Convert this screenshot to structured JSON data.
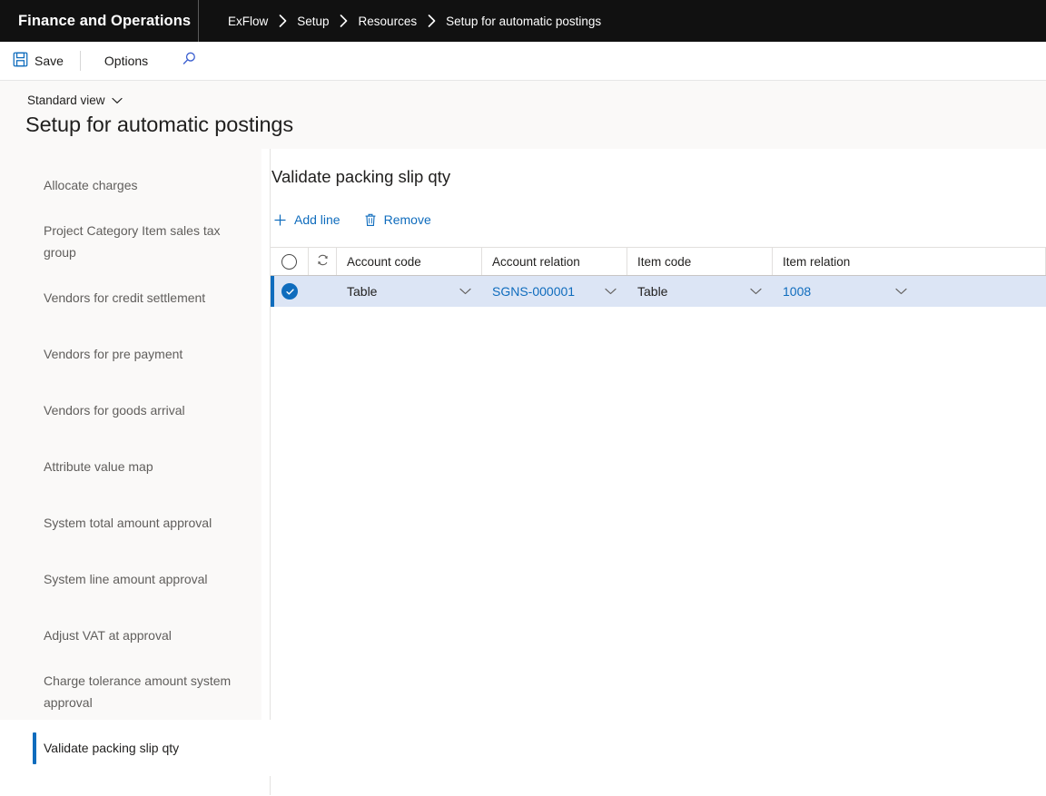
{
  "topbar": {
    "brand": "Finance and Operations",
    "breadcrumb": [
      "ExFlow",
      "Setup",
      "Resources",
      "Setup for automatic postings"
    ]
  },
  "commandbar": {
    "save_label": "Save",
    "options_label": "Options",
    "search_icon": "search-icon",
    "save_icon": "save-floppy-icon"
  },
  "page": {
    "view_selector": "Standard view",
    "title": "Setup for automatic postings"
  },
  "sidenav": {
    "items": [
      {
        "label": "Allocate charges",
        "selected": false
      },
      {
        "label": "Project Category Item sales tax group",
        "selected": false
      },
      {
        "label": "Vendors for credit settlement",
        "selected": false
      },
      {
        "label": "Vendors for pre payment",
        "selected": false
      },
      {
        "label": "Vendors for goods arrival",
        "selected": false
      },
      {
        "label": "Attribute value map",
        "selected": false
      },
      {
        "label": "System total amount approval",
        "selected": false
      },
      {
        "label": "System line amount approval",
        "selected": false
      },
      {
        "label": "Adjust VAT at approval",
        "selected": false
      },
      {
        "label": "Charge tolerance amount system approval",
        "selected": false
      },
      {
        "label": "Validate packing slip qty",
        "selected": true
      }
    ]
  },
  "panel": {
    "title": "Validate packing slip qty",
    "toolbar": {
      "add_line_label": "Add line",
      "add_line_icon": "plus-icon",
      "remove_label": "Remove",
      "remove_icon": "trash-icon"
    },
    "grid": {
      "select_all_icon": "select-all-circle-icon",
      "refresh_icon": "refresh-icon",
      "columns": [
        "Account code",
        "Account relation",
        "Item code",
        "Item relation"
      ],
      "rows": [
        {
          "selected": true,
          "row_selected_icon": "checkmark-circle-icon",
          "account_code": "Table",
          "account_relation": "SGNS-000001",
          "item_code": "Table",
          "item_relation": "1008"
        }
      ]
    }
  },
  "colors": {
    "accent": "#0f6cbd",
    "topbar_bg": "#111111",
    "row_selected_bg": "#dce5f5",
    "page_head_bg": "#faf9f8"
  }
}
